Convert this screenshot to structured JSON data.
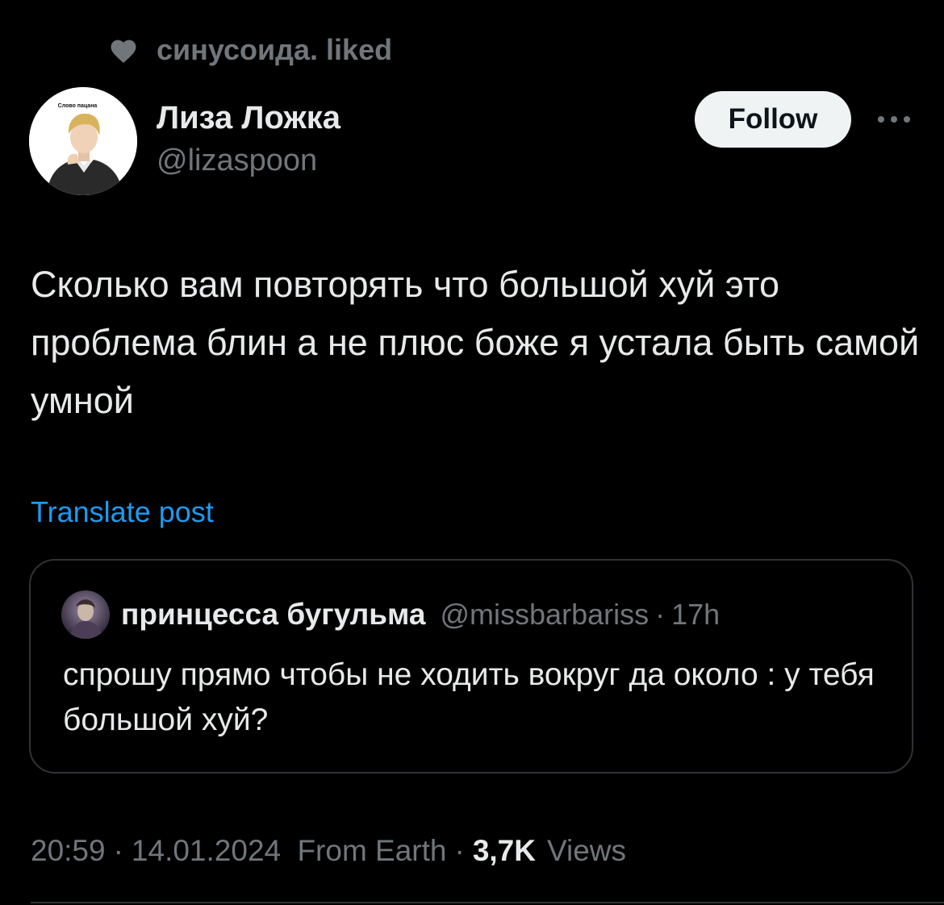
{
  "social_context": {
    "icon": "heart-icon",
    "text": "синусоида. liked"
  },
  "author": {
    "display_name": "Лиза Ложка",
    "handle": "@lizaspoon",
    "avatar_caption": "Слово пацана"
  },
  "actions": {
    "follow_label": "Follow",
    "more_icon": "more-horizontal-icon"
  },
  "post": {
    "text": "Сколько вам повторять что большой хуй это проблема блин а не плюс боже я устала быть самой умной",
    "translate_label": "Translate post"
  },
  "quote": {
    "display_name": "принцесса бугульма",
    "handle": "@missbarbariss",
    "separator": "·",
    "time": "17h",
    "text": "спрошу прямо чтобы не ходить вокруг да около : у тебя большой хуй?"
  },
  "meta": {
    "time": "20:59",
    "date": "14.01.2024",
    "location": "From Earth",
    "separator": "·",
    "views_count": "3,7K",
    "views_label": "Views"
  },
  "colors": {
    "background": "#000000",
    "primary_text": "#e7e9ea",
    "secondary_text": "#71767b",
    "link": "#1d9bf0",
    "border": "#2f3336",
    "follow_bg": "#eff3f4"
  }
}
